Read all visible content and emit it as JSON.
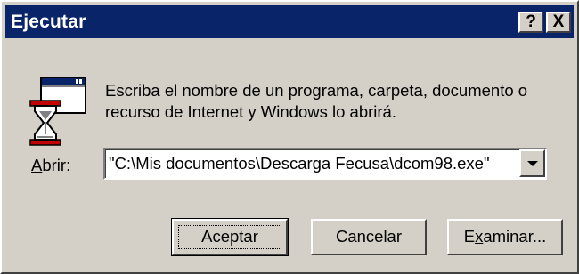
{
  "window": {
    "title": "Ejecutar",
    "help_label": "?",
    "close_label": "X"
  },
  "dialog": {
    "message_line1": "Escriba el nombre de un programa, carpeta, documento o",
    "message_line2": "recurso de Internet y Windows lo abrirá.",
    "open_label_accel": "A",
    "open_label_rest": "brir:",
    "open_value": "\"C:\\Mis documentos\\Descarga Fecusa\\dcom98.exe\""
  },
  "buttons": {
    "ok": "Aceptar",
    "cancel": "Cancelar",
    "browse_pre": "E",
    "browse_accel": "x",
    "browse_post": "aminar..."
  },
  "colors": {
    "title_bar": "#0a246a",
    "face": "#d4d0c8"
  }
}
